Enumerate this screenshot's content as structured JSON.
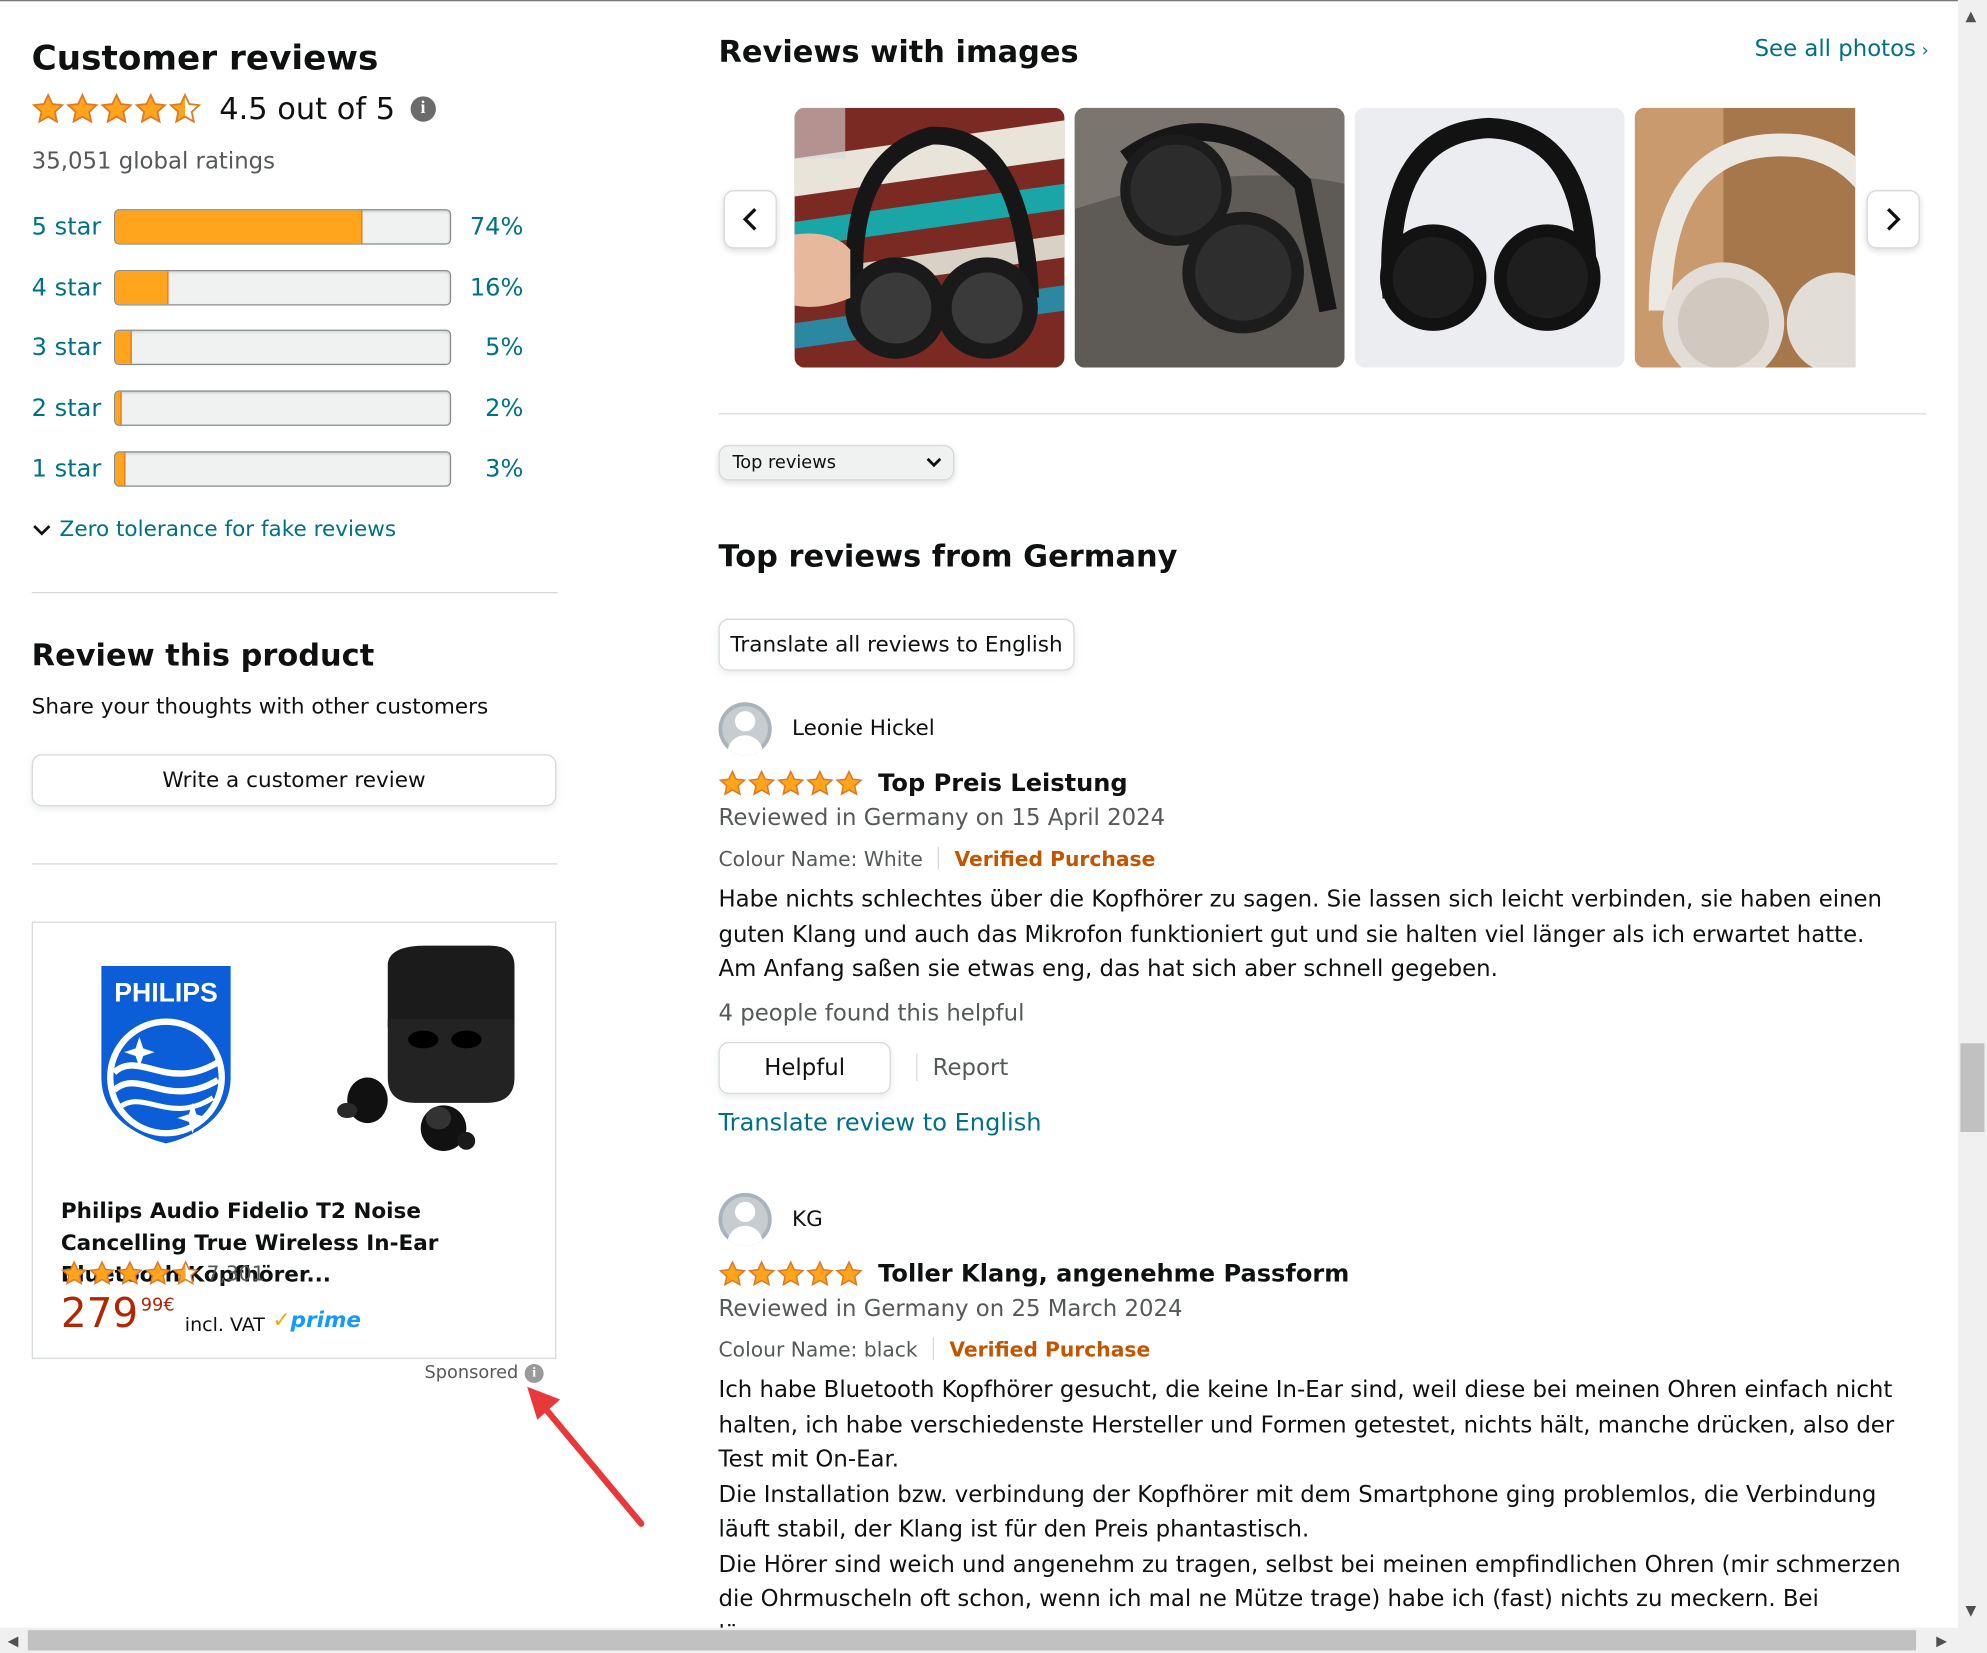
{
  "summary": {
    "title": "Customer reviews",
    "average_rating": 4.5,
    "average_text": "4.5 out of 5",
    "global_ratings": "35,051 global ratings",
    "histogram": [
      {
        "label": "5 star",
        "percent_text": "74%",
        "fraction": 0.74
      },
      {
        "label": "4 star",
        "percent_text": "16%",
        "fraction": 0.16
      },
      {
        "label": "3 star",
        "percent_text": "5%",
        "fraction": 0.05
      },
      {
        "label": "2 star",
        "percent_text": "2%",
        "fraction": 0.02
      },
      {
        "label": "1 star",
        "percent_text": "3%",
        "fraction": 0.03
      }
    ],
    "zero_tolerance": "Zero tolerance for fake reviews"
  },
  "review_product": {
    "title": "Review this product",
    "subtitle": "Share your thoughts with other customers",
    "button": "Write a customer review"
  },
  "ad": {
    "brand_logo": "PHILIPS",
    "title": "Philips Audio Fidelio T2 Noise Cancelling True Wireless In-Ear Bluetooth Kopfhörer...",
    "rating": 4.5,
    "rating_count": "7,301",
    "price_whole": "279",
    "price_fraction": "99",
    "currency": "€",
    "vat": "incl. VAT",
    "prime": "prime",
    "sponsored": "Sponsored"
  },
  "images": {
    "title": "Reviews with images",
    "see_all": "See all photos",
    "prev_icon": "chevron-left-icon",
    "next_icon": "chevron-right-icon"
  },
  "sort": {
    "selected": "Top reviews"
  },
  "top_reviews": {
    "title": "Top reviews from Germany",
    "translate_all": "Translate all reviews to English"
  },
  "reviews": [
    {
      "author": "Leonie Hickel",
      "rating": 5,
      "title": "Top Preis Leistung",
      "date": "Reviewed in Germany on 15 April 2024",
      "variant": "Colour Name: White",
      "verified": "Verified Purchase",
      "body": [
        "Habe nichts schlechtes über die Kopfhörer zu sagen. Sie lassen sich leicht verbinden, sie haben einen guten Klang und auch das Mikrofon funktioniert gut und sie halten viel länger als ich erwartet hatte.",
        "Am Anfang saßen sie etwas eng, das hat sich aber schnell gegeben."
      ],
      "helpful_count": "4 people found this helpful",
      "helpful": "Helpful",
      "report": "Report",
      "translate": "Translate review to English"
    },
    {
      "author": "KG",
      "rating": 5,
      "title": "Toller Klang, angenehme Passform",
      "date": "Reviewed in Germany on 25 March 2024",
      "variant": "Colour Name: black",
      "verified": "Verified Purchase",
      "body": [
        "Ich habe Bluetooth Kopfhörer gesucht, die keine In-Ear sind, weil diese bei meinen Ohren einfach nicht halten, ich habe verschiedenste Hersteller und Formen getestet, nichts hält, manche drücken, also der Test mit On-Ear.",
        "Die Installation bzw. verbindung der Kopfhörer mit dem Smartphone ging problemlos, die Verbindung läuft stabil, der Klang ist für den Preis phantastisch.",
        "Die Hörer sind weich und angenehm zu tragen, selbst bei meinen empfindlichen Ohren (mir schmerzen die Ohrmuscheln oft schon, wenn ich mal ne Mütze trage) habe ich (fast) nichts zu meckern. Bei längerem"
      ]
    }
  ],
  "colors": {
    "star": "#ffa41c",
    "link": "#007185",
    "verified": "#c45500",
    "price": "#b12704",
    "annotation_arrow": "#e8393a"
  }
}
